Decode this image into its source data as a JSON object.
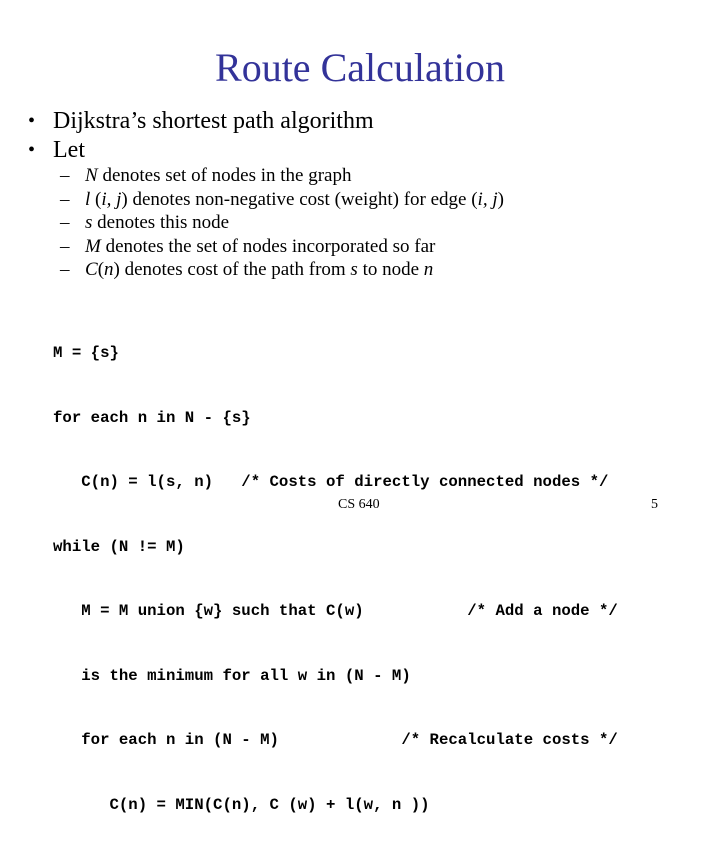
{
  "slide": {
    "title": "Route Calculation",
    "title_color": "#333399",
    "bullets": [
      {
        "marker": "•",
        "text": "Dijkstra’s shortest path algorithm"
      },
      {
        "marker": "•",
        "text": "Let"
      }
    ],
    "definitions": [
      {
        "marker": "–",
        "var": "N",
        "text": " denotes set of nodes in the graph"
      },
      {
        "marker": "–",
        "var": "l",
        "text_parts": [
          " (",
          "i, j",
          ") denotes non-negative cost (weight) for edge (",
          "i, j",
          ")"
        ]
      },
      {
        "marker": "–",
        "var": "s",
        "text": "  denotes this node"
      },
      {
        "marker": "–",
        "var": "M",
        "text": " denotes the set of nodes incorporated so far"
      },
      {
        "marker": "–",
        "var": "C",
        "text_parts": [
          "(",
          "n",
          ") denotes cost of the path from ",
          "s",
          " to node ",
          "n"
        ]
      }
    ],
    "code_lines": [
      "M = {s}",
      "for each n in N - {s}",
      "   C(n) = l(s, n)   /* Costs of directly connected nodes */",
      "while (N != M)",
      "   M = M union {w} such that C(w)           /* Add a node */",
      "   is the minimum for all w in (N - M)",
      "   for each n in (N - M)             /* Recalculate costs */",
      "      C(n) = MIN(C(n), C (w) + l(w, n ))"
    ],
    "footer": {
      "course": "CS 640",
      "page_number": "5"
    }
  }
}
